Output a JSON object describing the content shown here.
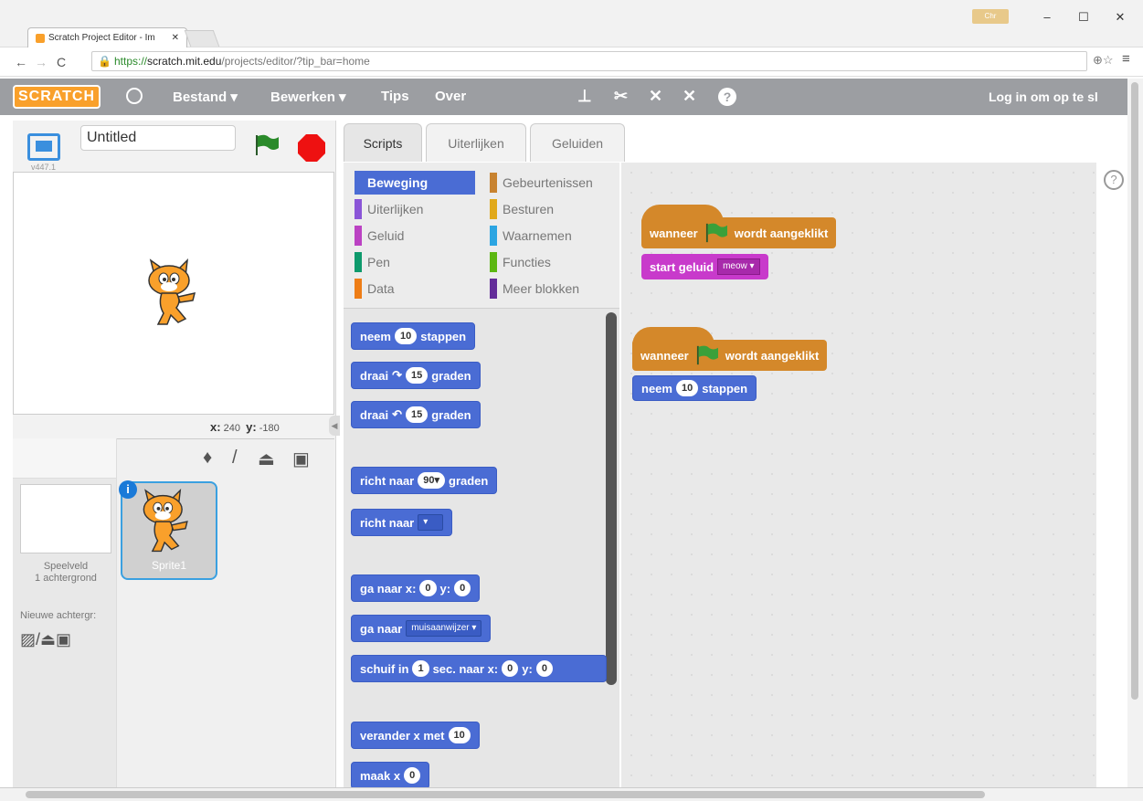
{
  "browser": {
    "tab_title": "Scratch Project Editor - Im",
    "url_scheme": "https://",
    "url_host": "scratch.mit.edu",
    "url_path": "/projects/editor/?tip_bar=home",
    "window_buttons": [
      "–",
      "☐",
      "✕"
    ]
  },
  "menu": {
    "logo": "SCRATCH",
    "items": [
      "Bestand ▾",
      "Bewerken ▾",
      "Tips",
      "Over"
    ],
    "login": "Log in om op te sl"
  },
  "stage": {
    "project_name": "Untitled",
    "version": "v447.1",
    "x_label": "x:",
    "x_value": "240",
    "y_label": "y:",
    "y_value": "-180"
  },
  "sprites": {
    "stage_label": "Speelveld",
    "stage_sub": "1 achtergrond",
    "new_backdrop": "Nieuwe achtergr:",
    "sprite_name": "Sprite1"
  },
  "tabs": [
    "Scripts",
    "Uiterlijken",
    "Geluiden"
  ],
  "categories": {
    "left": [
      {
        "label": "Beweging",
        "color": "#4a6cd4"
      },
      {
        "label": "Uiterlijken",
        "color": "#8a55d7"
      },
      {
        "label": "Geluid",
        "color": "#bb42c3"
      },
      {
        "label": "Pen",
        "color": "#0e9a6c"
      },
      {
        "label": "Data",
        "color": "#ee7d16"
      }
    ],
    "right": [
      {
        "label": "Gebeurtenissen",
        "color": "#c88330"
      },
      {
        "label": "Besturen",
        "color": "#e1a91a"
      },
      {
        "label": "Waarnemen",
        "color": "#2ca5e2"
      },
      {
        "label": "Functies",
        "color": "#5cb712"
      },
      {
        "label": "Meer blokken",
        "color": "#632d99"
      }
    ]
  },
  "palette_blocks": {
    "b1": {
      "pre": "neem",
      "v": "10",
      "post": "stappen"
    },
    "b2": {
      "pre": "draai",
      "v": "15",
      "post": "graden"
    },
    "b3": {
      "pre": "draai",
      "v": "15",
      "post": "graden"
    },
    "b4": {
      "pre": "richt naar",
      "v": "90▾",
      "post": "graden"
    },
    "b5": {
      "pre": "richt naar"
    },
    "b6": {
      "pre": "ga naar x:",
      "v1": "0",
      "mid": "y:",
      "v2": "0"
    },
    "b7": {
      "pre": "ga naar",
      "drop": "muisaanwijzer ▾"
    },
    "b8": {
      "pre": "schuif in",
      "v1": "1",
      "mid": "sec. naar x:",
      "v2": "0",
      "mid2": "y:",
      "v3": "0"
    },
    "b9": {
      "pre": "verander x met",
      "v": "10"
    },
    "b10": {
      "pre": "maak x",
      "v": "0"
    }
  },
  "scripts": {
    "s1_hat_pre": "wanneer",
    "s1_hat_post": "wordt aangeklikt",
    "s1_sound_pre": "start geluid",
    "s1_sound_val": "meow ▾",
    "s2_hat_pre": "wanneer",
    "s2_hat_post": "wordt aangeklikt",
    "s2_move_pre": "neem",
    "s2_move_val": "10",
    "s2_move_post": "stappen"
  },
  "colors": {
    "motion": "#4a6cd4",
    "events": "#d4882a",
    "sound": "#c83acb",
    "menubar": "#9c9ea2"
  }
}
